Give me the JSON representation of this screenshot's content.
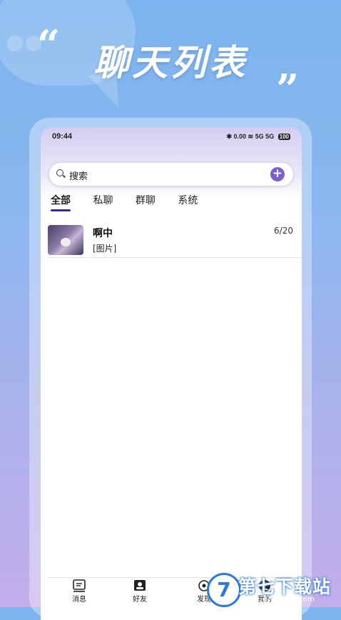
{
  "banner": {
    "open_quote": "“",
    "title": "聊天列表",
    "close_quote": "„"
  },
  "status_bar": {
    "time": "09:44",
    "icons": "✱ 0.00 ≋ 5G 5G",
    "battery": "100"
  },
  "search": {
    "placeholder": "搜索",
    "add_label": "+"
  },
  "tabs": [
    {
      "label": "全部",
      "active": true
    },
    {
      "label": "私聊",
      "active": false
    },
    {
      "label": "群聊",
      "active": false
    },
    {
      "label": "系统",
      "active": false
    }
  ],
  "chats": [
    {
      "name": "啊中",
      "preview": "[图片]",
      "date": "6/20"
    }
  ],
  "bottom_nav": [
    {
      "label": "消息",
      "icon": "message-icon"
    },
    {
      "label": "好友",
      "icon": "contacts-icon"
    },
    {
      "label": "发现",
      "icon": "discover-icon"
    },
    {
      "label": "我的",
      "icon": "profile-icon"
    }
  ],
  "watermark": {
    "logo": "7",
    "text": "第七下载站",
    "url": "www.d7down.com"
  },
  "colors": {
    "accent": "#7b5fd0",
    "tab_underline": "#3a2a8a",
    "background_top": "#7bb4ee",
    "background_bottom": "#c3aeea"
  }
}
